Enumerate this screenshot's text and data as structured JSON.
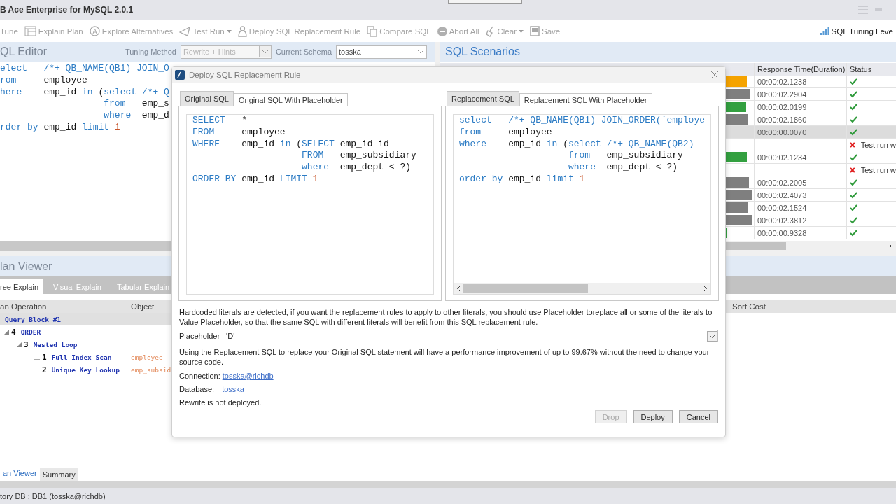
{
  "window": {
    "title": "B Ace Enterprise for MySQL 2.0.1"
  },
  "toolbar": {
    "items": [
      {
        "label": "Tune",
        "disabled": true,
        "dropdown": false
      },
      {
        "label": "Explain Plan",
        "disabled": true,
        "dropdown": false
      },
      {
        "label": "Explore Alternatives",
        "disabled": true,
        "dropdown": false
      },
      {
        "label": "Test Run",
        "disabled": true,
        "dropdown": true
      },
      {
        "label": "Deploy SQL Replacement Rule",
        "disabled": true,
        "dropdown": false
      },
      {
        "label": "Compare SQL",
        "disabled": true,
        "dropdown": false
      },
      {
        "label": "Abort All",
        "disabled": true,
        "dropdown": false
      },
      {
        "label": "Clear",
        "disabled": true,
        "dropdown": true
      },
      {
        "label": "Save",
        "disabled": true,
        "dropdown": false
      }
    ],
    "tuning_level": "SQL Tuning Leve"
  },
  "sql_editor": {
    "title": "QL Editor",
    "tuning_method": {
      "label": "Tuning Method",
      "value": "Rewrite + Hints",
      "disabled": true
    },
    "current_schema": {
      "label": "Current Schema",
      "value": "tosska",
      "disabled": false
    },
    "lines": [
      [
        {
          "kind": "keyword",
          "text": "elect   /*+ QB_NAME(QB1) JOIN_O"
        }
      ],
      [
        {
          "kind": "keyword",
          "text": "rom"
        },
        {
          "kind": "plain",
          "text": "     employee"
        }
      ],
      [
        {
          "kind": "keyword",
          "text": "here"
        },
        {
          "kind": "plain",
          "text": "    emp_id "
        },
        {
          "kind": "keyword",
          "text": "in"
        },
        {
          "kind": "plain",
          "text": " ("
        },
        {
          "kind": "keyword",
          "text": "select /*+ Q"
        }
      ],
      [
        {
          "kind": "keyword",
          "text": "                   from"
        },
        {
          "kind": "plain",
          "text": "   emp_s"
        }
      ],
      [
        {
          "kind": "keyword",
          "text": "                   where"
        },
        {
          "kind": "plain",
          "text": "  emp_d"
        }
      ],
      [
        {
          "kind": "keyword",
          "text": "rder by"
        },
        {
          "kind": "plain",
          "text": " emp_id "
        },
        {
          "kind": "keyword",
          "text": "limit"
        },
        {
          "kind": "number",
          "text": " 1"
        }
      ]
    ]
  },
  "sql_scenarios": {
    "title": "SQL Scenarios",
    "columns": [
      "Response Time(Duration)",
      "Status"
    ],
    "rows": [
      {
        "level": 0.93,
        "color": "#f5a300",
        "time": "00:00:02.1238",
        "kind": "ok",
        "selected": false
      },
      {
        "level": 0.97,
        "color": "#7f7f7f",
        "time": "00:00:02.2904",
        "kind": "ok",
        "selected": false
      },
      {
        "level": 0.92,
        "color": "#33a040",
        "time": "00:00:02.0199",
        "kind": "ok",
        "selected": false
      },
      {
        "level": 0.94,
        "color": "#7f7f7f",
        "time": "00:00:02.1860",
        "kind": "ok",
        "selected": false
      },
      {
        "time": "00:00:00.0070",
        "kind": "ok",
        "selected": true
      },
      {
        "kind": "error",
        "message": "Test run w",
        "selected": false
      },
      {
        "level": 0.93,
        "color": "#33a040",
        "time": "00:00:02.1234",
        "kind": "ok",
        "selected": false
      },
      {
        "kind": "error",
        "message": "Test run w",
        "selected": false
      },
      {
        "level": 0.95,
        "color": "#7f7f7f",
        "time": "00:00:02.2005",
        "kind": "ok",
        "selected": false
      },
      {
        "level": 0.99,
        "color": "#7f7f7f",
        "time": "00:00:02.4073",
        "kind": "ok",
        "selected": false
      },
      {
        "level": 0.94,
        "color": "#7f7f7f",
        "time": "00:00:02.1524",
        "kind": "ok",
        "selected": false
      },
      {
        "level": 0.99,
        "color": "#7f7f7f",
        "time": "00:00:02.3812",
        "kind": "ok",
        "selected": false
      },
      {
        "level": 0.7,
        "color": "#33a040",
        "time": "00:00:00.9328",
        "kind": "ok",
        "selected": false
      }
    ]
  },
  "plan_viewer": {
    "title": "lan Viewer",
    "tabs": [
      {
        "label": "ree Explain",
        "selected": true
      },
      {
        "label": "Visual Explain",
        "selected": false
      },
      {
        "label": "Tabular Explain",
        "selected": false
      }
    ],
    "columns": [
      "an Operation",
      "Object",
      "Sort Cost"
    ],
    "tree": [
      {
        "label": "Query Block #1",
        "selected": true,
        "children": [
          {
            "id": "4",
            "op": "ORDER",
            "expanded": true,
            "children": [
              {
                "id": "3",
                "op": "Nested Loop",
                "expanded": true,
                "children": [
                  {
                    "id": "1",
                    "op": "Full Index Scan",
                    "object": "employee"
                  },
                  {
                    "id": "2",
                    "op": "Unique Key Lookup",
                    "object": "emp_subsid"
                  }
                ]
              }
            ]
          }
        ]
      }
    ]
  },
  "dialog": {
    "title": "Deploy SQL Replacement Rule",
    "panels": [
      {
        "tabs": [
          {
            "label": "Original SQL",
            "selected": false
          },
          {
            "label": "Original SQL With Placeholder",
            "selected": true
          }
        ],
        "lines": [
          [
            {
              "kind": "keyword",
              "text": "SELECT"
            },
            {
              "kind": "plain",
              "text": "   *"
            }
          ],
          [
            {
              "kind": "keyword",
              "text": "FROM"
            },
            {
              "kind": "plain",
              "text": "     employee"
            }
          ],
          [
            {
              "kind": "keyword",
              "text": "WHERE"
            },
            {
              "kind": "plain",
              "text": "    emp_id "
            },
            {
              "kind": "keyword",
              "text": "in"
            },
            {
              "kind": "plain",
              "text": " ("
            },
            {
              "kind": "keyword",
              "text": "SELECT"
            },
            {
              "kind": "plain",
              "text": " emp_id id"
            }
          ],
          [
            {
              "kind": "keyword",
              "text": "                    FROM"
            },
            {
              "kind": "plain",
              "text": "   emp_subsidiary"
            }
          ],
          [
            {
              "kind": "keyword",
              "text": "                    where"
            },
            {
              "kind": "plain",
              "text": "  emp_dept < ?)"
            }
          ],
          [
            {
              "kind": "keyword",
              "text": "ORDER BY"
            },
            {
              "kind": "plain",
              "text": " emp_id "
            },
            {
              "kind": "keyword",
              "text": "LIMIT"
            },
            {
              "kind": "number",
              "text": " 1"
            }
          ]
        ]
      },
      {
        "tabs": [
          {
            "label": "Replacement SQL",
            "selected": false
          },
          {
            "label": "Replacement SQL With Placeholder",
            "selected": true
          }
        ],
        "lines": [
          [
            {
              "kind": "keyword",
              "text": "select   /*+ QB_NAME(QB1) JOIN_ORDER(`employe"
            }
          ],
          [
            {
              "kind": "keyword",
              "text": "from"
            },
            {
              "kind": "plain",
              "text": "     employee"
            }
          ],
          [
            {
              "kind": "keyword",
              "text": "where"
            },
            {
              "kind": "plain",
              "text": "    emp_id "
            },
            {
              "kind": "keyword",
              "text": "in"
            },
            {
              "kind": "plain",
              "text": " ("
            },
            {
              "kind": "keyword",
              "text": "select /*+ QB_NAME(QB2)"
            }
          ],
          [
            {
              "kind": "keyword",
              "text": "                    from"
            },
            {
              "kind": "plain",
              "text": "   emp_subsidiary"
            }
          ],
          [
            {
              "kind": "keyword",
              "text": "                    where"
            },
            {
              "kind": "plain",
              "text": "  emp_dept < ?)"
            }
          ],
          [
            {
              "kind": "keyword",
              "text": "order by"
            },
            {
              "kind": "plain",
              "text": " emp_id "
            },
            {
              "kind": "keyword",
              "text": "limit"
            },
            {
              "kind": "number",
              "text": " 1"
            }
          ]
        ]
      }
    ],
    "notice": "Hardcoded literals are detected, if you want the replacement rules to apply to other literals, you should use Placeholder toreplace all or some of the literals to Value Placeholder, so that the same SQL with different literals will benefit from this SQL replacement rule.",
    "placeholder": {
      "label": "Placeholder",
      "value": "'D'"
    },
    "improvement": "Using the Replacement SQL to replace your Original SQL statement will have a performance improvement of up to 99.67% without the need to change your source code.",
    "connection": {
      "label": "Connection:",
      "value": "tosska@richdb"
    },
    "database": {
      "label": "Database:",
      "value": "tosska"
    },
    "status": "Rewrite is not deployed.",
    "buttons": [
      {
        "label": "Drop",
        "disabled": true
      },
      {
        "label": "Deploy",
        "disabled": false
      },
      {
        "label": "Cancel",
        "disabled": false
      }
    ]
  },
  "bottom_tabs": [
    {
      "label": "an Viewer",
      "selected": true
    },
    {
      "label": "Summary",
      "selected": false
    }
  ],
  "status_bar": "tory DB : DB1 (tosska@richdb)"
}
